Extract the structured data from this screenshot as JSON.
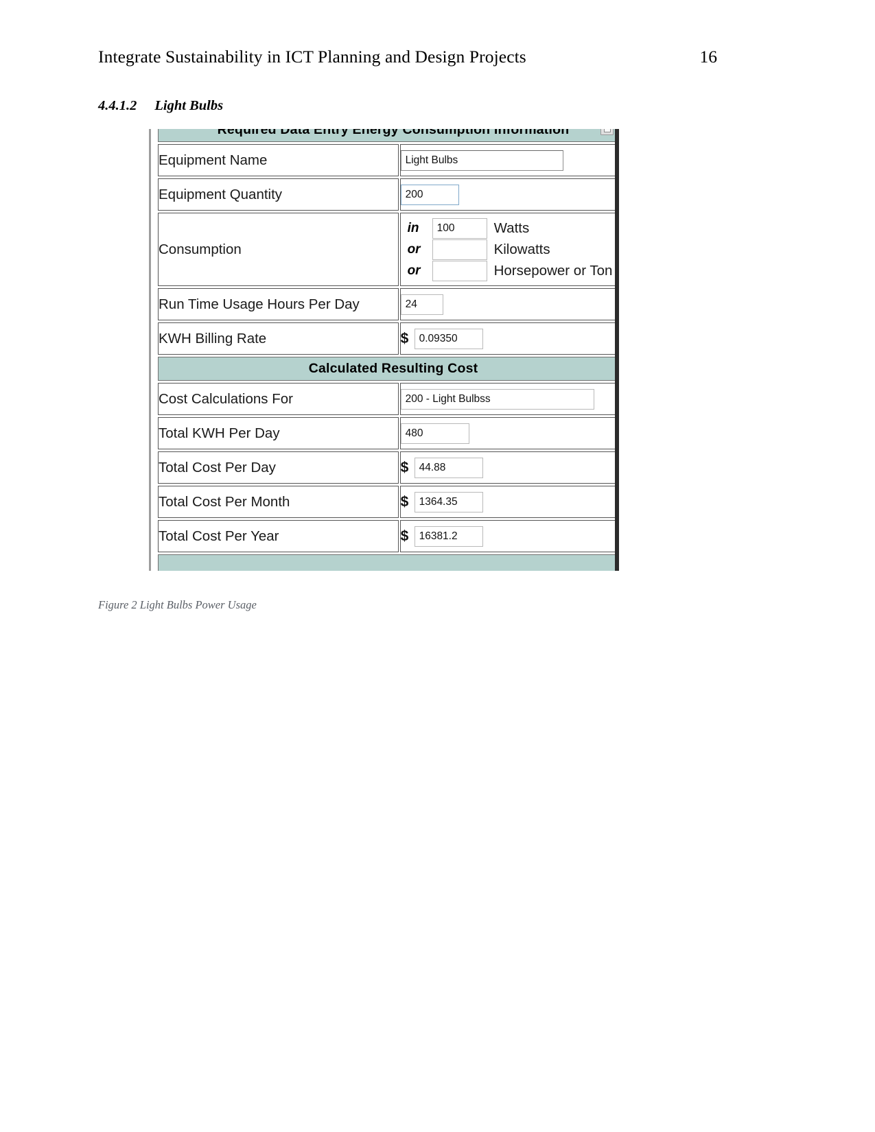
{
  "header": {
    "doc_title": "Integrate Sustainability in ICT Planning and Design Projects",
    "page_number": "16"
  },
  "section": {
    "number": "4.4.1.2",
    "title": "Light Bulbs"
  },
  "figure": {
    "caption": "Figure 2 Light Bulbs Power Usage",
    "banner_top": "Required Data Entry Energy Consumption Information",
    "banner_mid": "Calculated Resulting Cost",
    "colors": {
      "banner_bg": "#b5d2ce",
      "frame_dark": "#2b2b2b",
      "frame_gray": "#9e9e9e"
    },
    "rows": {
      "equipment_name": {
        "label": "Equipment Name",
        "value": "Light Bulbs"
      },
      "equipment_quantity": {
        "label": "Equipment Quantity",
        "value": "200"
      },
      "consumption": {
        "label": "Consumption",
        "entries": [
          {
            "prefix": "in",
            "value": "100",
            "unit": "Watts"
          },
          {
            "prefix": "or",
            "value": "",
            "unit": "Kilowatts"
          },
          {
            "prefix": "or",
            "value": "",
            "unit": "Horsepower or Ton"
          }
        ]
      },
      "run_time": {
        "label": "Run Time Usage Hours Per Day",
        "value": "24"
      },
      "billing_rate": {
        "label": "KWH Billing Rate",
        "currency": "$",
        "value": "0.09350"
      },
      "cost_calculations_for": {
        "label": "Cost Calculations For",
        "value": "200 - Light Bulbss"
      },
      "total_kwh_per_day": {
        "label": "Total KWH Per Day",
        "value": "480"
      },
      "total_cost_per_day": {
        "label": "Total Cost Per Day",
        "currency": "$",
        "value": "44.88"
      },
      "total_cost_per_month": {
        "label": "Total Cost Per Month",
        "currency": "$",
        "value": "1364.35"
      },
      "total_cost_per_year": {
        "label": "Total Cost Per Year",
        "currency": "$",
        "value": "16381.2"
      }
    }
  }
}
